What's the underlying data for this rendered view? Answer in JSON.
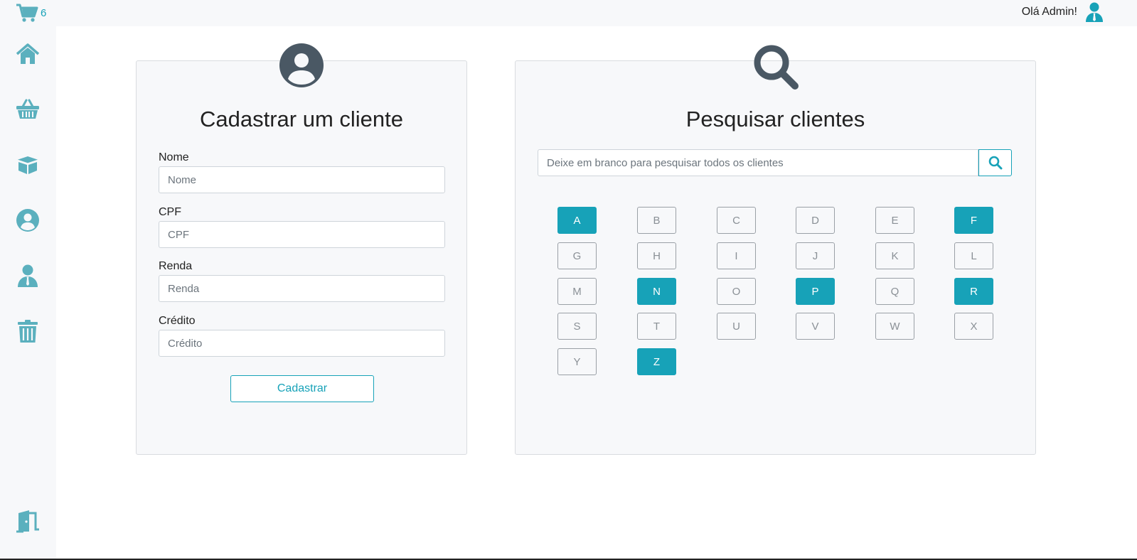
{
  "topbar": {
    "cart_count": "6",
    "greeting": "Olá Admin!"
  },
  "colors": {
    "accent": "#17a2b8",
    "icon_sidebar": "#5bb0be",
    "icon_dark": "#4a5864"
  },
  "sidebar": {
    "items": [
      {
        "icon": "home-icon"
      },
      {
        "icon": "basket-icon"
      },
      {
        "icon": "box-icon"
      },
      {
        "icon": "user-circle-icon"
      },
      {
        "icon": "user-tie-icon"
      },
      {
        "icon": "trash-icon"
      },
      {
        "icon": "door-exit-icon"
      }
    ]
  },
  "register": {
    "title": "Cadastrar um cliente",
    "fields": [
      {
        "label": "Nome",
        "placeholder": "Nome"
      },
      {
        "label": "CPF",
        "placeholder": "CPF"
      },
      {
        "label": "Renda",
        "placeholder": "Renda"
      },
      {
        "label": "Crédito",
        "placeholder": "Crédito"
      }
    ],
    "submit_label": "Cadastrar"
  },
  "search": {
    "title": "Pesquisar clientes",
    "placeholder": "Deixe em branco para pesquisar todos os clientes",
    "letters": [
      {
        "letter": "A",
        "active": true
      },
      {
        "letter": "B",
        "active": false
      },
      {
        "letter": "C",
        "active": false
      },
      {
        "letter": "D",
        "active": false
      },
      {
        "letter": "E",
        "active": false
      },
      {
        "letter": "F",
        "active": true
      },
      {
        "letter": "G",
        "active": false
      },
      {
        "letter": "H",
        "active": false
      },
      {
        "letter": "I",
        "active": false
      },
      {
        "letter": "J",
        "active": false
      },
      {
        "letter": "K",
        "active": false
      },
      {
        "letter": "L",
        "active": false
      },
      {
        "letter": "M",
        "active": false
      },
      {
        "letter": "N",
        "active": true
      },
      {
        "letter": "O",
        "active": false
      },
      {
        "letter": "P",
        "active": true
      },
      {
        "letter": "Q",
        "active": false
      },
      {
        "letter": "R",
        "active": true
      },
      {
        "letter": "S",
        "active": false
      },
      {
        "letter": "T",
        "active": false
      },
      {
        "letter": "U",
        "active": false
      },
      {
        "letter": "V",
        "active": false
      },
      {
        "letter": "W",
        "active": false
      },
      {
        "letter": "X",
        "active": false
      },
      {
        "letter": "Y",
        "active": false
      },
      {
        "letter": "Z",
        "active": true
      }
    ]
  }
}
